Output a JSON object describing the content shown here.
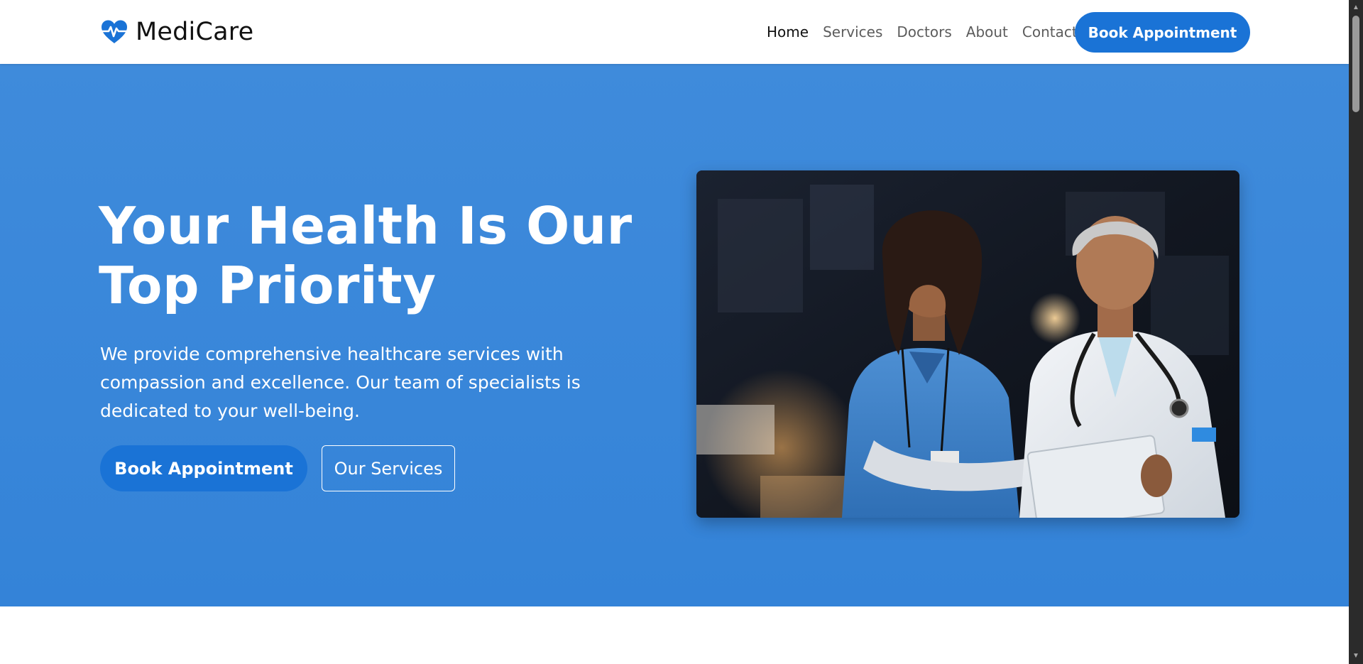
{
  "brand": {
    "name": "MediCare",
    "icon": "heart-pulse-icon",
    "icon_color": "#1a73d6"
  },
  "nav": {
    "links": [
      {
        "label": "Home",
        "active": true
      },
      {
        "label": "Services",
        "active": false
      },
      {
        "label": "Doctors",
        "active": false
      },
      {
        "label": "About",
        "active": false
      },
      {
        "label": "Contact",
        "active": false
      }
    ],
    "cta_label": "Book Appointment"
  },
  "hero": {
    "title": "Your Health Is Our Top Priority",
    "description": "We provide comprehensive healthcare services with compassion and excellence. Our team of specialists is dedicated to your well-being.",
    "primary_button": "Book Appointment",
    "secondary_button": "Our Services",
    "image_subject": "doctors-reviewing-tablet-photo"
  },
  "colors": {
    "accent": "#1a73d6",
    "hero_background": "#3a87da",
    "text_on_hero": "#ffffff",
    "nav_text": "#5c5c5c",
    "nav_active_text": "#111111"
  }
}
